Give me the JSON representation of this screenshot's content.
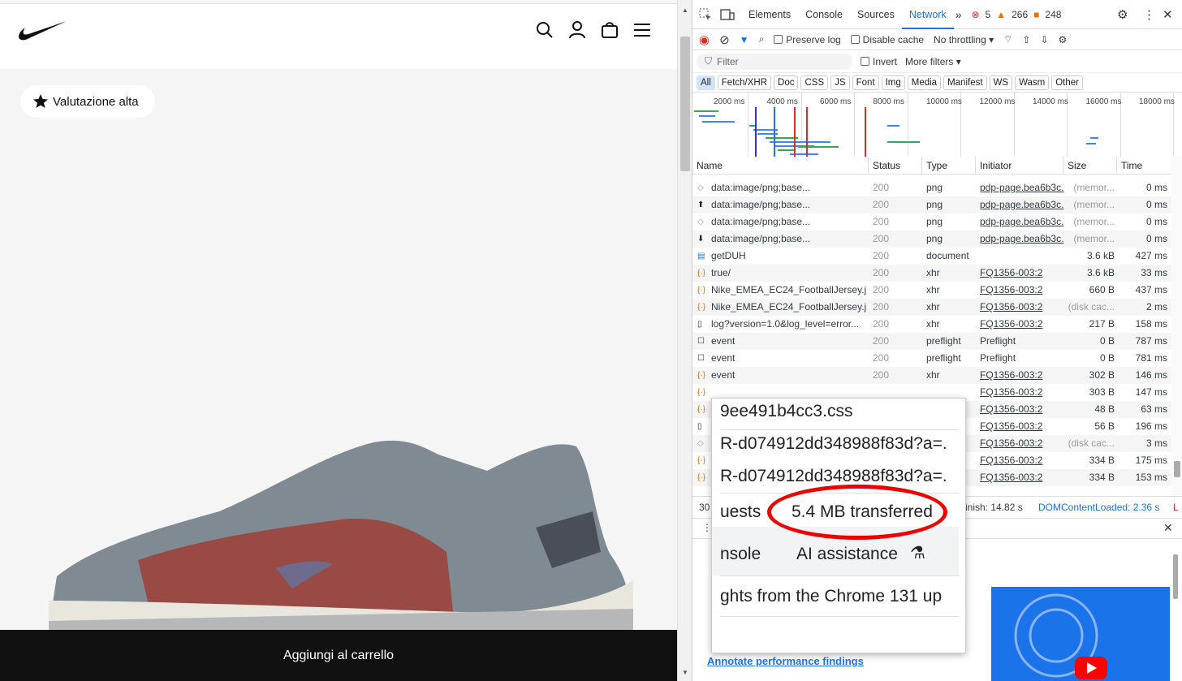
{
  "page": {
    "badge_label": "Valutazione alta",
    "cart_button": "Aggiungi al carrello"
  },
  "devtools": {
    "tabs": [
      "Elements",
      "Console",
      "Sources",
      "Network"
    ],
    "active_tab": "Network",
    "errors": "5",
    "warnings": "266",
    "issues": "248",
    "preserve_log": "Preserve log",
    "disable_cache": "Disable cache",
    "throttling": "No throttling",
    "filter_placeholder": "Filter",
    "invert": "Invert",
    "more_filters": "More filters",
    "type_filters": [
      "All",
      "Fetch/XHR",
      "Doc",
      "CSS",
      "JS",
      "Font",
      "Img",
      "Media",
      "Manifest",
      "WS",
      "Wasm",
      "Other"
    ],
    "timeline_ticks": [
      "2000 ms",
      "4000 ms",
      "6000 ms",
      "8000 ms",
      "10000 ms",
      "12000 ms",
      "14000 ms",
      "16000 ms",
      "18000 ms"
    ],
    "columns": [
      "Name",
      "Status",
      "Type",
      "Initiator",
      "Size",
      "Time"
    ],
    "rows": [
      {
        "name": "data:image/png;base...",
        "status": "200",
        "type": "png",
        "initiator": "pdp-page.bea6b3c.",
        "size": "(memor...",
        "time": "0 ms",
        "icon": "image-icon"
      },
      {
        "name": "data:image/png;base...",
        "status": "200",
        "type": "png",
        "initiator": "pdp-page.bea6b3c.",
        "size": "(memor...",
        "time": "0 ms",
        "icon": "arrow-up-icon"
      },
      {
        "name": "data:image/png;base...",
        "status": "200",
        "type": "png",
        "initiator": "pdp-page.bea6b3c.",
        "size": "(memor...",
        "time": "0 ms",
        "icon": "image-icon"
      },
      {
        "name": "data:image/png;base...",
        "status": "200",
        "type": "png",
        "initiator": "pdp-page.bea6b3c.",
        "size": "(memor...",
        "time": "0 ms",
        "icon": "arrow-down-icon"
      },
      {
        "name": "getDUH",
        "status": "200",
        "type": "document",
        "initiator": "",
        "size": "3.6 kB",
        "time": "427 ms",
        "icon": "document-icon"
      },
      {
        "name": "true/",
        "status": "200",
        "type": "xhr",
        "initiator": "FQ1356-003:2",
        "size": "3.6 kB",
        "time": "33 ms",
        "icon": "xhr-icon"
      },
      {
        "name": "Nike_EMEA_EC24_FootballJersey.j...",
        "status": "200",
        "type": "xhr",
        "initiator": "FQ1356-003:2",
        "size": "660 B",
        "time": "437 ms",
        "icon": "xhr-icon"
      },
      {
        "name": "Nike_EMEA_EC24_FootballJersey.j...",
        "status": "200",
        "type": "xhr",
        "initiator": "FQ1356-003:2",
        "size": "(disk cac...",
        "time": "2 ms",
        "icon": "xhr-icon"
      },
      {
        "name": "log?version=1.0&log_level=error...",
        "status": "200",
        "type": "xhr",
        "initiator": "FQ1356-003:2",
        "size": "217 B",
        "time": "158 ms",
        "icon": "file-icon"
      },
      {
        "name": "event",
        "status": "200",
        "type": "preflight",
        "initiator": "Preflight",
        "size": "0 B",
        "time": "787 ms",
        "icon": "square-icon"
      },
      {
        "name": "event",
        "status": "200",
        "type": "preflight",
        "initiator": "Preflight",
        "size": "0 B",
        "time": "781 ms",
        "icon": "square-icon"
      },
      {
        "name": "event",
        "status": "200",
        "type": "xhr",
        "initiator": "FQ1356-003:2",
        "size": "302 B",
        "time": "146 ms",
        "icon": "xhr-icon"
      },
      {
        "name": "",
        "status": "",
        "type": "",
        "initiator": "FQ1356-003:2",
        "size": "303 B",
        "time": "147 ms",
        "icon": "xhr-icon"
      },
      {
        "name": "",
        "status": "",
        "type": "",
        "initiator": "FQ1356-003:2",
        "size": "48 B",
        "time": "63 ms",
        "icon": "xhr-icon"
      },
      {
        "name": "",
        "status": "",
        "type": "",
        "initiator": "FQ1356-003:2",
        "size": "56 B",
        "time": "196 ms",
        "icon": "file-icon"
      },
      {
        "name": "",
        "status": "",
        "type": "",
        "initiator": "FQ1356-003:2",
        "size": "(disk cac...",
        "time": "3 ms",
        "icon": "image-icon"
      },
      {
        "name": "",
        "status": "",
        "type": "",
        "initiator": "FQ1356-003:2",
        "size": "334 B",
        "time": "175 ms",
        "icon": "xhr-icon"
      },
      {
        "name": "",
        "status": "",
        "type": "",
        "initiator": "FQ1356-003:2",
        "size": "334 B",
        "time": "153 ms",
        "icon": "xhr-icon"
      }
    ],
    "status_bar": {
      "requests": "30",
      "finish": "inish: 14.82 s",
      "dcl": "DOMContentLoaded: 2.36 s",
      "load": "L"
    },
    "annotate_link": "Annotate performance findings"
  },
  "zoom_popup": {
    "line1": "9ee491b4cc3.css",
    "line2": "R-d074912dd348988f83d?a=.",
    "line3": "R-d074912dd348988f83d?a=.",
    "requests": "uests",
    "transferred": "5.4 MB transferred",
    "console": "nsole",
    "ai_assistance": "AI assistance",
    "chrome_line": "ghts from the Chrome 131 up"
  },
  "colors": {
    "accent": "#1a73e8",
    "annotation_red": "#e00000"
  }
}
